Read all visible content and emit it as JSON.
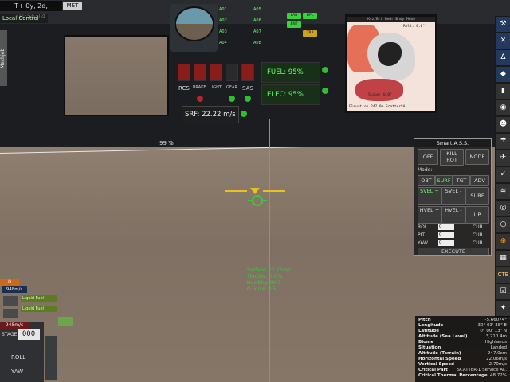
{
  "top": {
    "met_time": "T+ 0y, 2d, 01:56:14",
    "met_button": "MET",
    "local_control": "Local Control",
    "mechjeb_tab": "Mechjeb"
  },
  "cockpit": {
    "toggles": [
      "RCS",
      "BRAKE",
      "LIGHT",
      "GEAR",
      "SAS"
    ],
    "indicator_buttons": [
      "A01",
      "A02",
      "A03",
      "A04",
      "A05",
      "A06",
      "A07",
      "A08"
    ],
    "green_buttons": [
      "LAB",
      "DPL",
      "ENT",
      "TRP"
    ],
    "fuel": "FUEL: 95%",
    "elec": "ELEC: 95%",
    "srf": "SRF: 22.22 m/s",
    "screen_header": "Kvz/Brt  Hedr    Bndy  Mebo",
    "screen_top_readout": "Roll: 0.0°",
    "screen_slope": "Slope: 0.0°",
    "screen_footer": "Elevation  247.0m  ScatterSA"
  },
  "hud": {
    "percent_label": "99 %",
    "surface": "Surface: 22.22m/s",
    "throttle": "Throttle: 0.0 %",
    "heading": "Heading: 90.0",
    "gforce": "G Force: 0.5"
  },
  "smart_ass": {
    "title": "Smart A.S.S.",
    "row1": [
      "OFF",
      "KILL ROT",
      "NODE"
    ],
    "mode_label": "Mode:",
    "modes": [
      "OBT",
      "SURF",
      "TGT",
      "ADV"
    ],
    "row2": [
      "SVEL +",
      "SVEL -",
      "SURF"
    ],
    "row3": [
      "HVEL +",
      "HVEL -",
      "UP"
    ],
    "rol": {
      "label": "ROL",
      "value": "0",
      "cur": "CUR"
    },
    "pit": {
      "label": "PIT",
      "value": "0",
      "cur": "CUR"
    },
    "yaw": {
      "label": "YAW",
      "value": "0",
      "cur": "CUR"
    },
    "execute": "EXECUTE"
  },
  "toolbar": {
    "items": [
      "tools-icon",
      "wrench-icon",
      "delta-v-icon",
      "navball-icon",
      "engine-icon",
      "alarm-icon",
      "kerbal-icon",
      "parachute-icon",
      "rover-icon",
      "aircraft-icon",
      "map-icon",
      "target-icon",
      "ring-icon",
      "orange-icon",
      "grid-icon",
      "ctb-icon",
      "checklist-icon",
      "helicopter-icon",
      "document-icon"
    ],
    "ctb_label": "CTB"
  },
  "stage": {
    "alt_speed": "948m/s",
    "stage_count": "000",
    "stage_label": "STAGE",
    "roll_label": "ROLL",
    "yaw_label": "YAW",
    "speed_small": "948m/s",
    "counter": "0",
    "fuel_label_1": "Liquid Fuel",
    "fuel_label_2": "Liquid Fuel"
  },
  "vessel_info": {
    "rows": [
      {
        "k": "Pitch",
        "v": "-5.66074°"
      },
      {
        "k": "Longitude",
        "v": "30° 03' 38\" E"
      },
      {
        "k": "Latitude",
        "v": "0° 00' 13\" N"
      },
      {
        "k": "Altitude (Sea Level)",
        "v": "3,210.4m"
      },
      {
        "k": "Biome",
        "v": "Highlands"
      },
      {
        "k": "Situation",
        "v": "Landed"
      },
      {
        "k": "Altitude (Terrain)",
        "v": "247.0cm"
      },
      {
        "k": "Horizontal Speed",
        "v": "22.06m/s"
      },
      {
        "k": "Vertical Speed",
        "v": "-2.70m/s"
      },
      {
        "k": "Critical Part",
        "v": "SCATTER-1 Service Ai.."
      },
      {
        "k": "Critical Thermal Percentage",
        "v": "48.72%"
      }
    ]
  }
}
